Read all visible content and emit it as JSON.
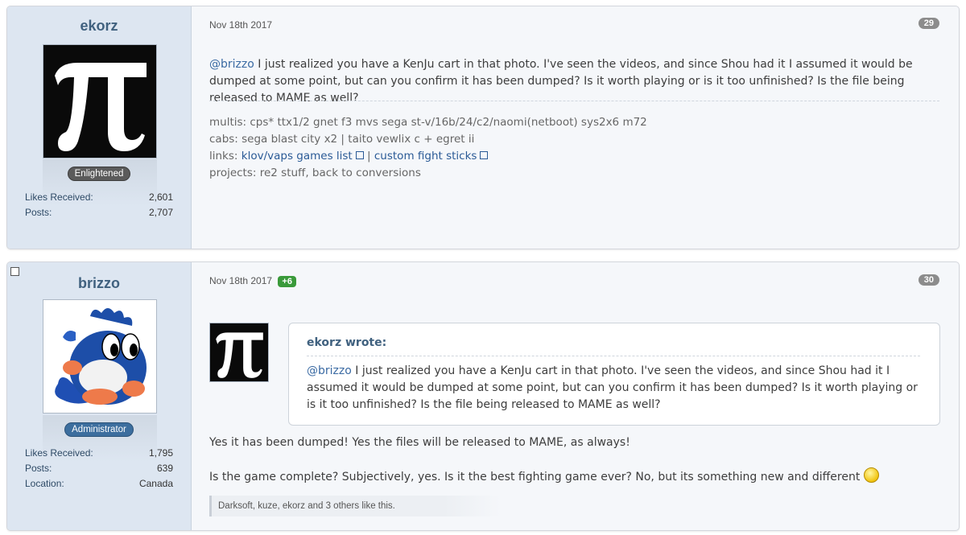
{
  "posts": [
    {
      "author": "ekorz",
      "badge": "Enlightened",
      "stats": [
        {
          "label": "Likes Received:",
          "value": "2,601"
        },
        {
          "label": "Posts:",
          "value": "2,707"
        }
      ],
      "date": "Nov 18th 2017",
      "number": "29",
      "mention": "@brizzo",
      "text": " I just realized you have a KenJu cart in that photo. I've seen the videos, and since Shou had it I assumed it would be dumped at some point, but can you confirm it has been dumped? Is it worth playing or is it too unfinished? Is the file being released to MAME as well?",
      "signature": {
        "multis": "multis: cps* ttx1/2 gnet f3 mvs sega st-v/16b/24/c2/naomi(netboot) sys2x6 m72",
        "cabs": "cabs: sega blast city x2 | taito vewlix c + egret ii",
        "links_prefix": "links: ",
        "link1": "klov/vaps games list",
        "link_sep": " | ",
        "link2": "custom fight sticks",
        "projects": "projects: re2 stuff, back to conversions"
      }
    },
    {
      "author": "brizzo",
      "badge": "Administrator",
      "stats": [
        {
          "label": "Likes Received:",
          "value": "1,795"
        },
        {
          "label": "Posts:",
          "value": "639"
        },
        {
          "label": "Location:",
          "value": "Canada"
        }
      ],
      "date": "Nov 18th 2017",
      "plus": "+6",
      "number": "30",
      "quote": {
        "author": "ekorz wrote:",
        "mention": "@brizzo",
        "text": " I just realized you have a KenJu cart in that photo. I've seen the videos, and since Shou had it I assumed it would be dumped at some point, but can you confirm it has been dumped? Is it worth playing or is it too unfinished? Is the file being released to MAME as well?"
      },
      "reply1": "Yes it has been dumped! Yes the files will be released to MAME, as always!",
      "reply2": "Is the game complete? Subjectively, yes. Is it the best fighting game ever? No, but its something new and different ",
      "likes": "Darksoft, kuze, ekorz and 3 others like this."
    }
  ]
}
